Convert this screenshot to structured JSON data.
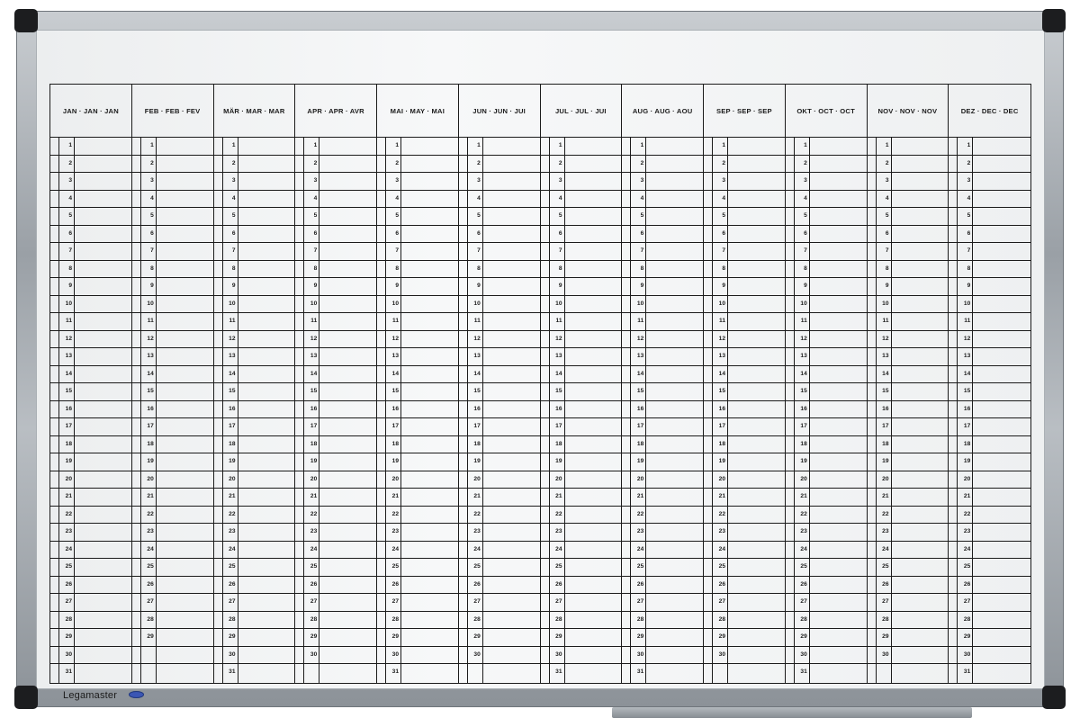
{
  "brand": {
    "name": "Legamaster"
  },
  "months": [
    {
      "label": "JAN · JAN · JAN",
      "days": 31
    },
    {
      "label": "FEB · FEB · FEV",
      "days": 29
    },
    {
      "label": "MÄR · MAR · MAR",
      "days": 31
    },
    {
      "label": "APR · APR · AVR",
      "days": 30
    },
    {
      "label": "MAI · MAY · MAI",
      "days": 31
    },
    {
      "label": "JUN · JUN · JUI",
      "days": 30
    },
    {
      "label": "JUL · JUL · JUI",
      "days": 31
    },
    {
      "label": "AUG · AUG · AOU",
      "days": 31
    },
    {
      "label": "SEP · SEP · SEP",
      "days": 30
    },
    {
      "label": "OKT · OCT · OCT",
      "days": 31
    },
    {
      "label": "NOV · NOV · NOV",
      "days": 30
    },
    {
      "label": "DEZ · DEC · DEC",
      "days": 31
    }
  ]
}
